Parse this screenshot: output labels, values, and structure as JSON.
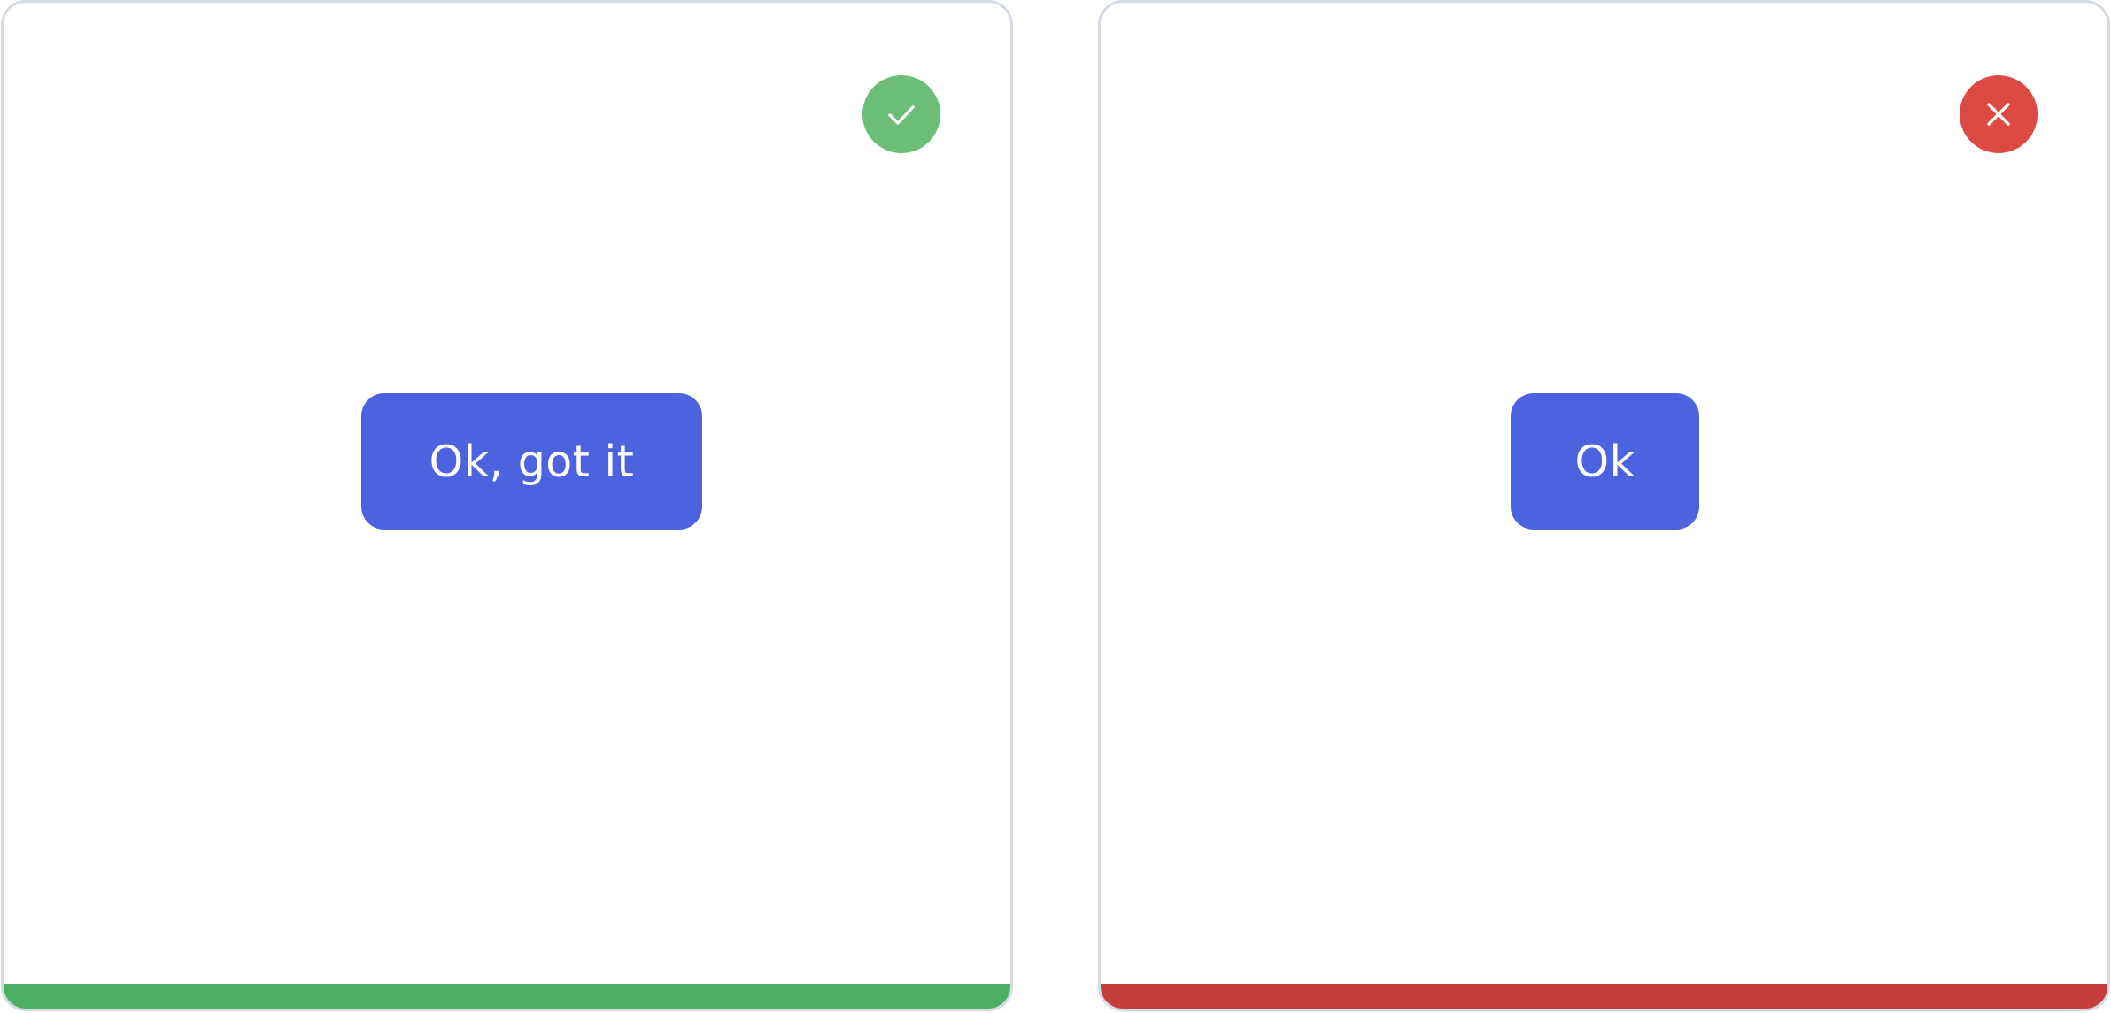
{
  "panels": [
    {
      "verdict": "correct",
      "icon": "check-icon",
      "button_label": "Ok, got it",
      "colors": {
        "icon_bg": "#6cbd76",
        "bar": "#4caf64",
        "button": "#4b63df"
      }
    },
    {
      "verdict": "incorrect",
      "icon": "close-icon",
      "button_label": "Ok",
      "colors": {
        "icon_bg": "#dd4a44",
        "bar": "#c53d3a",
        "button": "#4b63df"
      }
    }
  ]
}
